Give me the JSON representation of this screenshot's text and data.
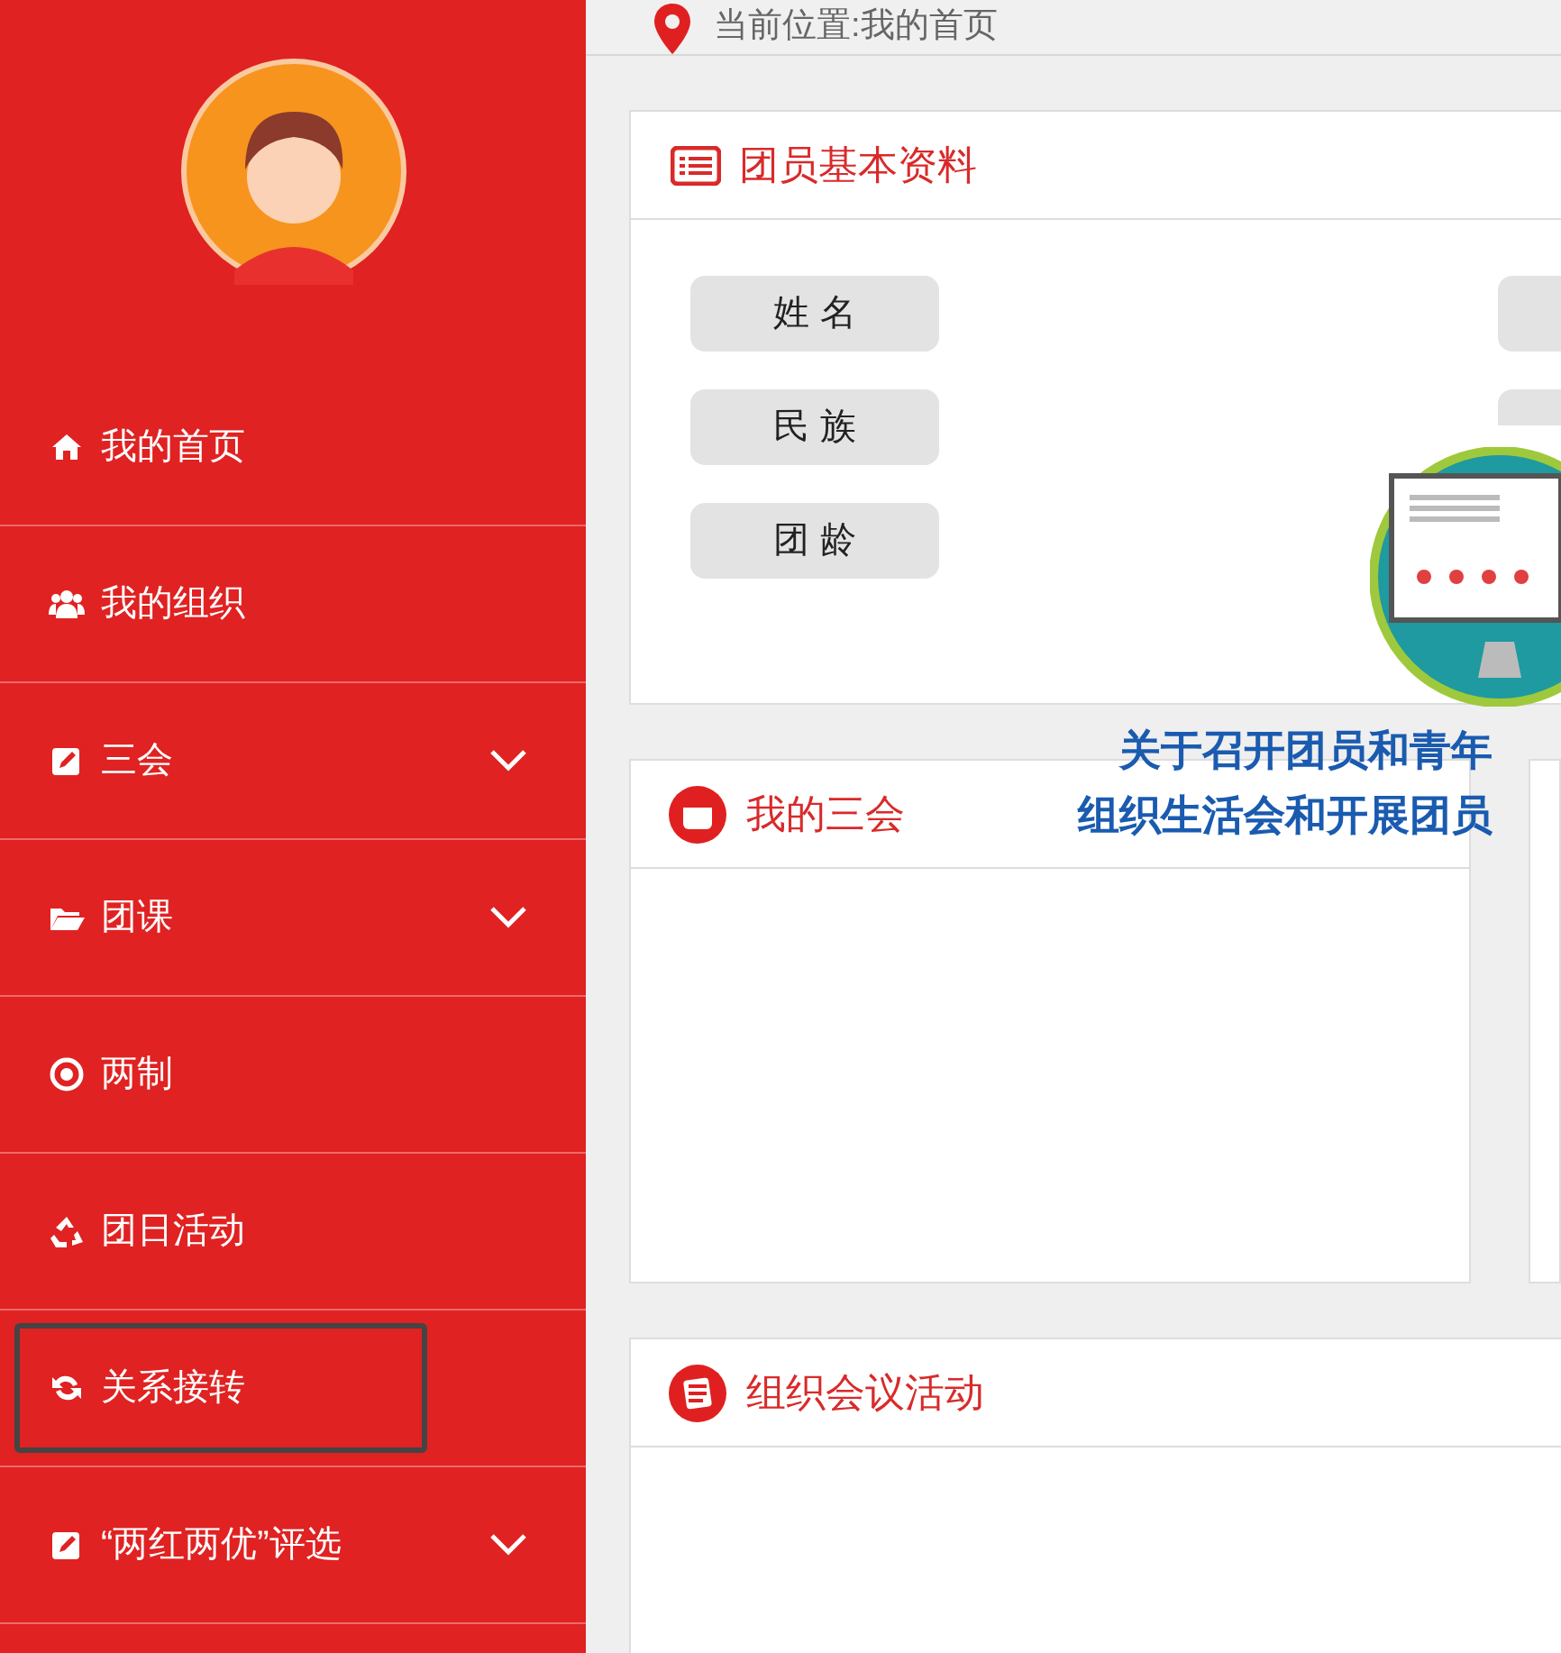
{
  "sidebar": {
    "items": [
      {
        "label": "我的首页",
        "expandable": false,
        "selected": false
      },
      {
        "label": "我的组织",
        "expandable": false,
        "selected": false
      },
      {
        "label": "三会",
        "expandable": true,
        "selected": false
      },
      {
        "label": "团课",
        "expandable": true,
        "selected": false
      },
      {
        "label": "两制",
        "expandable": false,
        "selected": false
      },
      {
        "label": "团日活动",
        "expandable": false,
        "selected": false
      },
      {
        "label": "关系接转",
        "expandable": false,
        "selected": true
      },
      {
        "label": "“两红两优”评选",
        "expandable": true,
        "selected": false
      }
    ]
  },
  "breadcrumb": "当前位置:我的首页",
  "profile_card": {
    "title": "团员基本资料",
    "fields": [
      "姓 名",
      "民 族",
      "团 龄"
    ]
  },
  "meetings_card": {
    "title": "我的三会"
  },
  "activities_card": {
    "title": "组织会议活动"
  },
  "overlay_caption": [
    "关于召开团员和青年",
    "组织生活会和开展团员"
  ]
}
